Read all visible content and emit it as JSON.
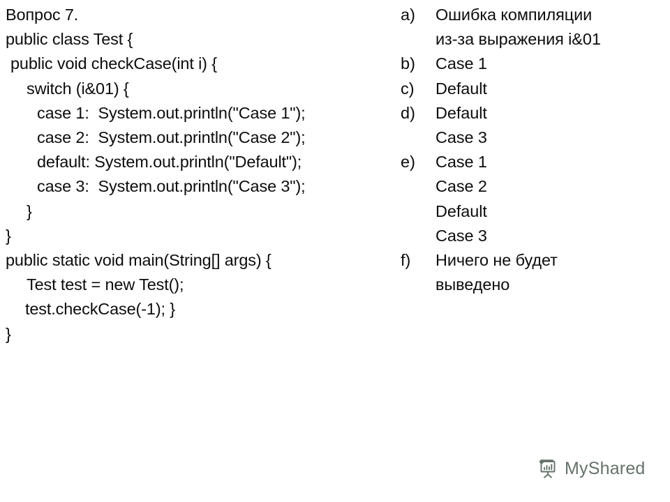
{
  "slide": {
    "background_color": "#ffffff",
    "text_color": "#0d0d0d"
  },
  "question": {
    "title": "Вопрос 7.",
    "code_lines": [
      {
        "text": "public class Test {",
        "indent": 0
      },
      {
        "text": "public void checkCase(int i) {",
        "indent": 1
      },
      {
        "text": "switch (i&01) {",
        "indent": 2
      },
      {
        "text": "case 1:  System.out.println(\"Case 1\");",
        "indent": 3
      },
      {
        "text": "case 2:  System.out.println(\"Case 2\");",
        "indent": 3
      },
      {
        "text": "default: System.out.println(\"Default\");",
        "indent": 3
      },
      {
        "text": "case 3:  System.out.println(\"Case 3\");",
        "indent": 3
      },
      {
        "text": "}",
        "indent": 2
      },
      {
        "text": "}",
        "indent": 0
      },
      {
        "text": "public static void main(String[] args) {",
        "indent": 0
      },
      {
        "text": "Test test = new Test();",
        "indent": 2
      },
      {
        "text": "test.checkCase(-1); }",
        "indent": 4
      },
      {
        "text": "}",
        "indent": 0
      }
    ]
  },
  "options": [
    {
      "marker": "a)",
      "lines": [
        "Ошибка компиляции",
        "из-за выражения i&01"
      ]
    },
    {
      "marker": "b)",
      "lines": [
        "Case 1"
      ]
    },
    {
      "marker": "c)",
      "lines": [
        "Default"
      ]
    },
    {
      "marker": "d)",
      "lines": [
        "Default",
        "Case 3"
      ]
    },
    {
      "marker": "e)",
      "lines": [
        "Case 1",
        "Case 2",
        "Default",
        "Case 3"
      ]
    },
    {
      "marker": "f)",
      "lines": [
        "Ничего не будет",
        "выведено"
      ]
    }
  ],
  "watermark": {
    "text": "MyShared",
    "icon": "presentation-easel-chart-icon",
    "color": "#4a5a4f"
  }
}
